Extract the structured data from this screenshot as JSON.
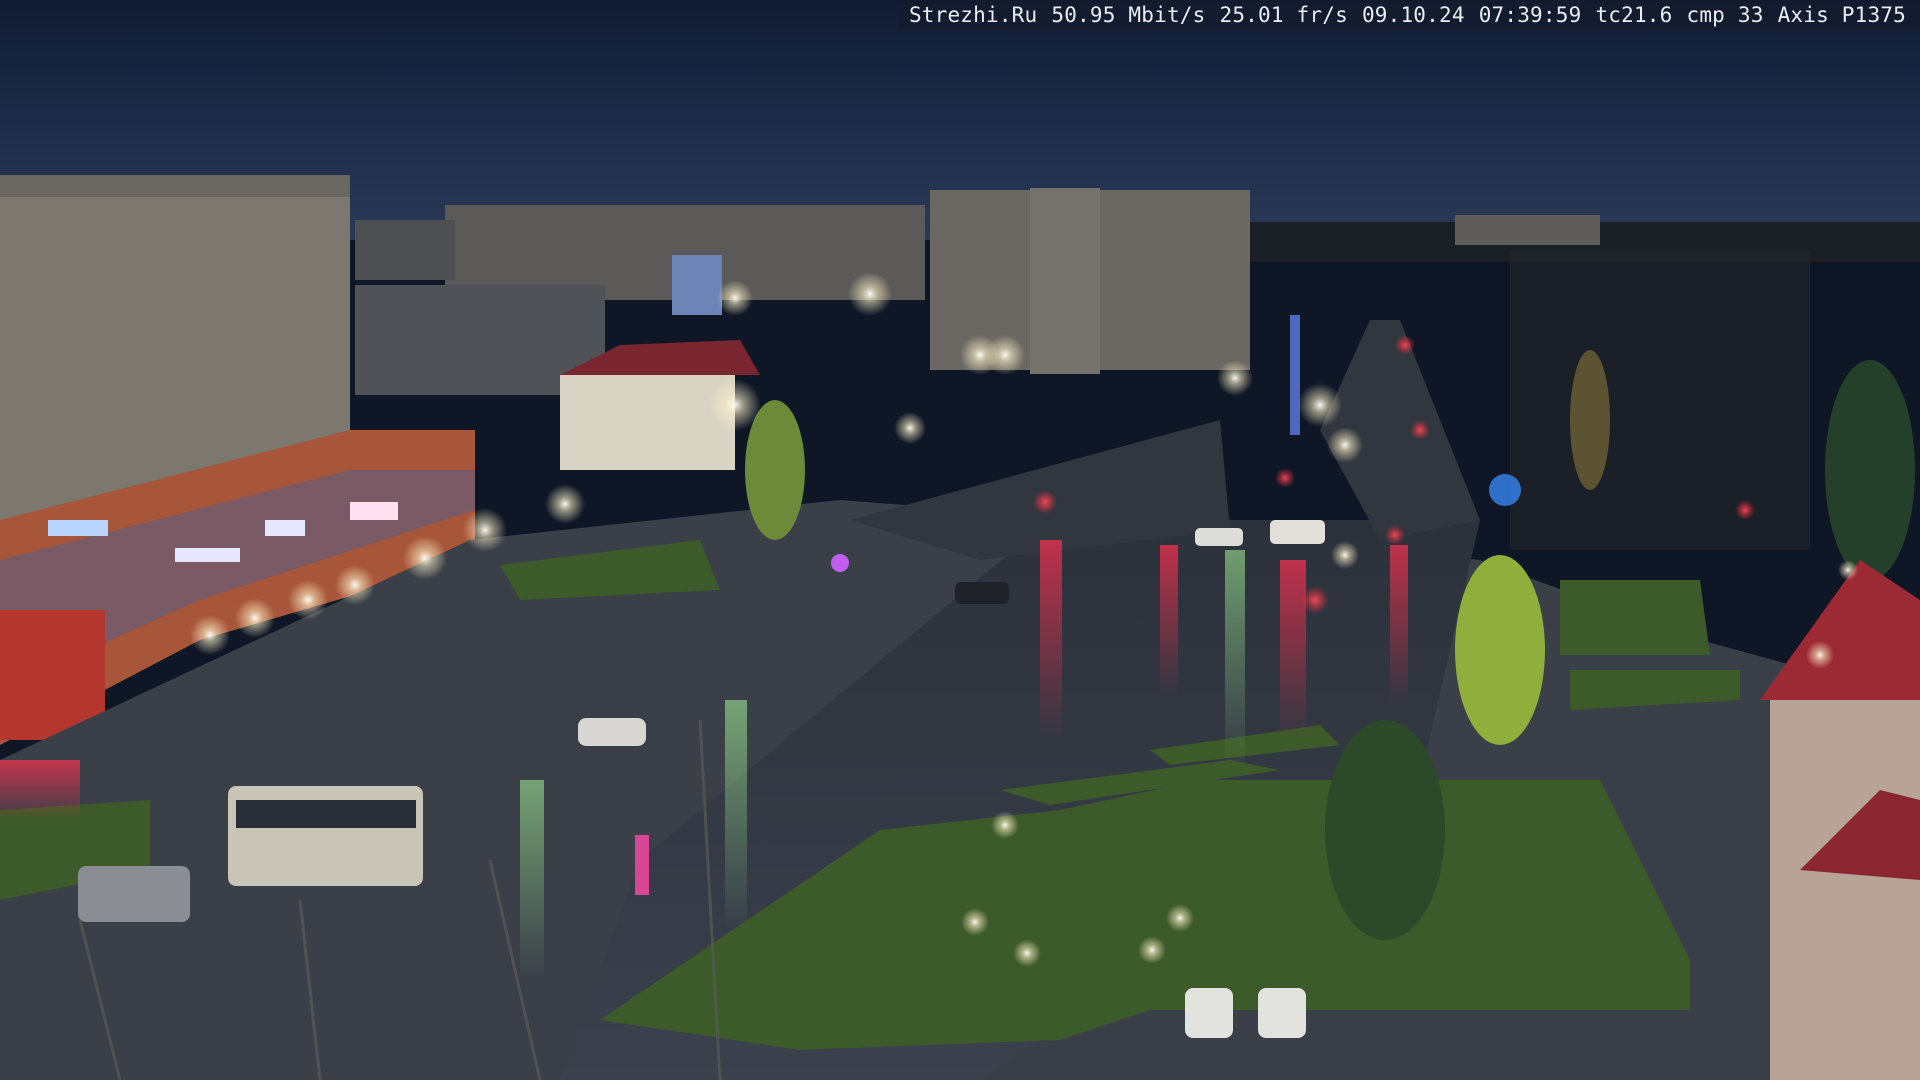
{
  "camera_overlay": {
    "site": "Strezhi.Ru",
    "bitrate": "50.95 Mbit/s",
    "framerate": "25.01 fr/s",
    "date": "09.10.24",
    "time": "07:39:59",
    "tc": "tc21.6",
    "cmp": "cmp 33",
    "model": "Axis P1375"
  },
  "scene": {
    "subject": "Night view of a wet town square with a crossroad, apartment blocks, a shopping centre, a bus and street lamps",
    "sky_color": "#1b2a45",
    "road_color": "#3a404c",
    "grass_color": "#3f5a2c",
    "lamp_color": "#f4f1df",
    "traffic_red": "#ff2a3a"
  }
}
